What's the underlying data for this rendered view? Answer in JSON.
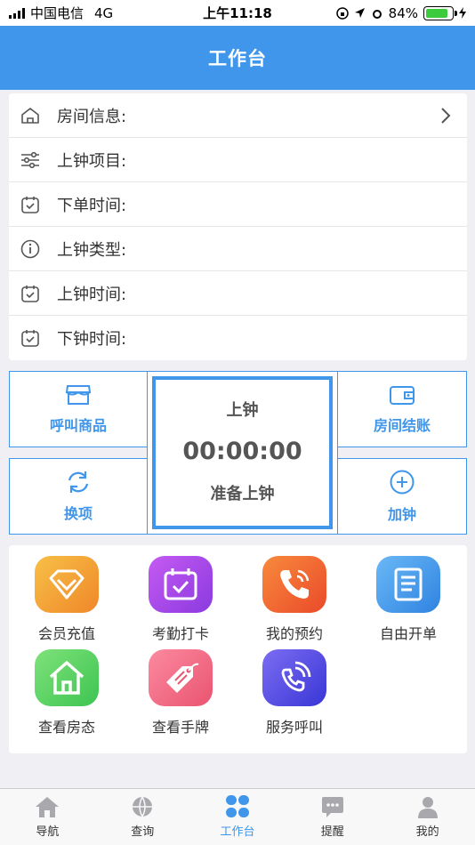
{
  "status_bar": {
    "carrier": "中国电信",
    "network": "4G",
    "time": "上午11:18",
    "battery": "84%",
    "battery_level": 0.84
  },
  "header": {
    "title": "工作台"
  },
  "info_rows": [
    {
      "label": "房间信息:",
      "icon": "home-icon",
      "has_chevron": true
    },
    {
      "label": "上钟项目:",
      "icon": "sliders-icon"
    },
    {
      "label": "下单时间:",
      "icon": "calendar-check-icon"
    },
    {
      "label": "上钟类型:",
      "icon": "info-icon"
    },
    {
      "label": "上钟时间:",
      "icon": "calendar-check-icon"
    },
    {
      "label": "下钟时间:",
      "icon": "calendar-check-icon"
    }
  ],
  "actions": {
    "call_goods": "呼叫商品",
    "room_checkout": "房间结账",
    "swap_item": "换项",
    "add_time": "加钟"
  },
  "clock": {
    "status": "上钟",
    "time": "00:00:00",
    "ready": "准备上钟"
  },
  "functions": [
    {
      "label": "会员充值",
      "icon": "diamond-icon",
      "color": "#f5a623"
    },
    {
      "label": "考勤打卡",
      "icon": "calendar-check-icon",
      "color": "#a64ce8"
    },
    {
      "label": "我的预约",
      "icon": "phone-icon",
      "color": "#f26a2c"
    },
    {
      "label": "自由开单",
      "icon": "document-icon",
      "color": "#3f96ea"
    },
    {
      "label": "查看房态",
      "icon": "house-icon",
      "color": "#4cd964"
    },
    {
      "label": "查看手牌",
      "icon": "tag-icon",
      "color": "#f06b83"
    },
    {
      "label": "服务呼叫",
      "icon": "phone-call-icon",
      "color": "#5b55e6"
    }
  ],
  "tabs": [
    {
      "label": "导航",
      "icon": "home-icon"
    },
    {
      "label": "查询",
      "icon": "globe-icon"
    },
    {
      "label": "工作台",
      "icon": "grid-icon",
      "active": true
    },
    {
      "label": "提醒",
      "icon": "chat-icon"
    },
    {
      "label": "我的",
      "icon": "user-icon"
    }
  ],
  "colors": {
    "accent": "#3f96ea",
    "background": "#efeff4"
  }
}
